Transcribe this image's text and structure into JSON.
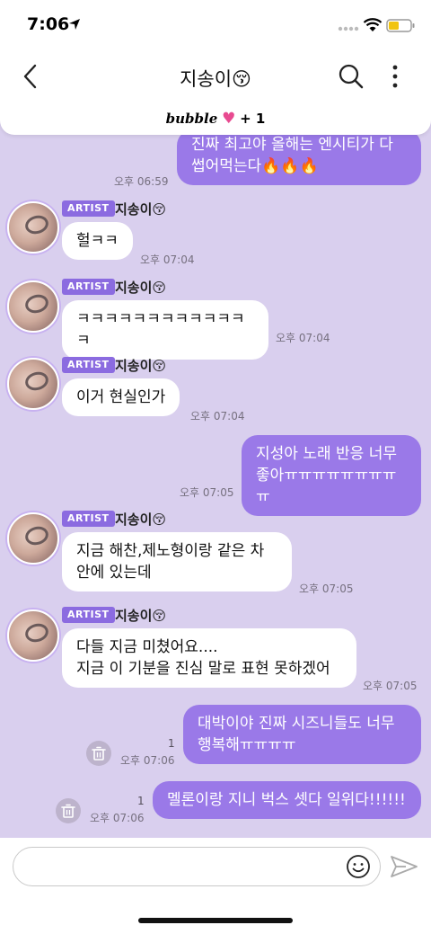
{
  "status": {
    "time": "7:06"
  },
  "header": {
    "title": "지송이😚"
  },
  "banner": {
    "word": "bubble",
    "heart": "♥",
    "plus": "+ 1"
  },
  "messages": [
    {
      "from": "me",
      "text": "진짜 최고야 올해는 엔시티가 다\n썹어먹는다🔥🔥🔥",
      "time": "오후 06:59"
    },
    {
      "from": "artist",
      "badge": "ARTIST",
      "name": "지송이😚",
      "text": "헐ㅋㅋ",
      "time": "오후 07:04"
    },
    {
      "from": "artist",
      "badge": "ARTIST",
      "name": "지송이😚",
      "text": "ㅋㅋㅋㅋㅋㅋㅋㅋㅋㅋㅋㅋㅋ",
      "time": "오후 07:04"
    },
    {
      "from": "artist",
      "badge": "ARTIST",
      "name": "지송이😚",
      "text": "이거 현실인가",
      "time": "오후 07:04"
    },
    {
      "from": "me",
      "text": "지성아 노래 반응 너무\n좋아ㅠㅠㅠㅠㅠㅠㅠㅠㅠ",
      "time": "오후 07:05"
    },
    {
      "from": "artist",
      "badge": "ARTIST",
      "name": "지송이😚",
      "text": "지금 해찬,제노형이랑 같은 차\n안에 있는데",
      "time": "오후 07:05"
    },
    {
      "from": "artist",
      "badge": "ARTIST",
      "name": "지송이😚",
      "text": "다들 지금 미쳤어요....\n지금 이 기분을 진심 말로 표현 못하겠어",
      "time": "오후 07:05"
    },
    {
      "from": "me",
      "text": "대박이야 진짜 시즈니들도 너무\n행복해ㅠㅠㅠㅠ",
      "time": "오후 07:06",
      "unread": "1"
    },
    {
      "from": "me",
      "text": "멜론이랑 지니 벅스 셋다 일위다!!!!!!",
      "time": "오후 07:06",
      "unread": "1"
    }
  ],
  "input": {
    "placeholder": ""
  },
  "colors": {
    "chat_bg": "#d9cfee",
    "my_bubble": "#9a79e8",
    "artist_badge": "#8b6be0"
  },
  "icons": [
    "location-arrow-icon",
    "signal-icon",
    "wifi-icon",
    "battery-icon",
    "back-arrow-icon",
    "search-icon",
    "more-icon",
    "trash-icon",
    "smile-icon",
    "send-icon"
  ]
}
